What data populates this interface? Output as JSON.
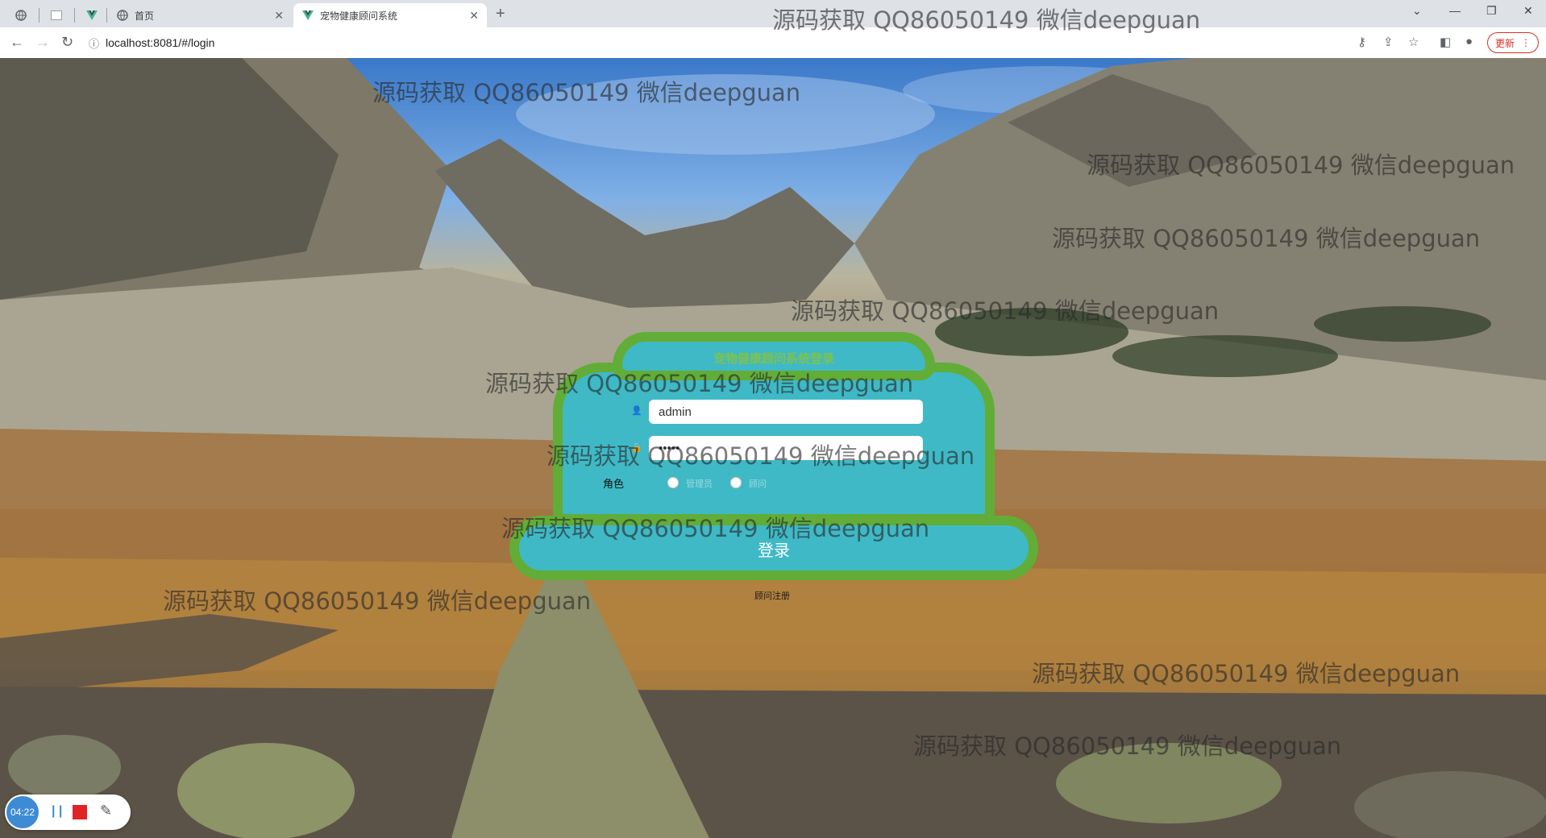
{
  "browser": {
    "tabs": [
      {
        "label": "",
        "icon": "globe-icon"
      },
      {
        "label": "",
        "icon": "blank-page-icon"
      },
      {
        "label": "",
        "icon": "vue-icon"
      },
      {
        "label": "首页",
        "icon": "globe-icon"
      },
      {
        "label": "宠物健康顾问系统",
        "icon": "vue-icon",
        "active": true
      }
    ],
    "url": "localhost:8081/#/login",
    "update_label": "更新"
  },
  "login": {
    "title": "宠物健康顾问系统登录",
    "username_value": "admin",
    "password_value": "•••••",
    "role_label": "角色",
    "role_options": [
      "管理员",
      "顾问"
    ],
    "login_button": "登录",
    "register_link": "顾问注册"
  },
  "watermark": {
    "text": "源码获取 QQ86050149 微信deepguan"
  },
  "recorder": {
    "time": "04:22"
  },
  "colors": {
    "card_fill": "#3fb9c6",
    "card_border": "#62ad37",
    "title_green": "#7fc24c"
  }
}
